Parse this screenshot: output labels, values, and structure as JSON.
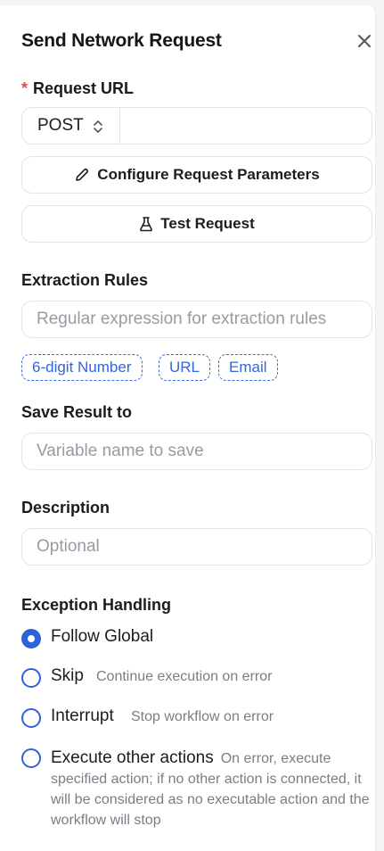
{
  "header": {
    "title": "Send Network Request"
  },
  "request_url": {
    "required_marker": "*",
    "label": "Request URL",
    "method": "POST",
    "value": ""
  },
  "buttons": {
    "configure": "Configure Request Parameters",
    "test": "Test Request"
  },
  "extraction": {
    "label": "Extraction Rules",
    "placeholder": "Regular expression for extraction rules",
    "tags": [
      "6-digit Number",
      "URL",
      "Email"
    ]
  },
  "save_result": {
    "label": "Save Result to",
    "placeholder": "Variable name to save"
  },
  "description": {
    "label": "Description",
    "placeholder": "Optional"
  },
  "exception": {
    "label": "Exception Handling",
    "selected": "follow_global",
    "options": [
      {
        "label": "Follow Global",
        "desc": ""
      },
      {
        "label": "Skip",
        "desc": "Continue execution on error"
      },
      {
        "label": "Interrupt",
        "desc": "Stop workflow on error"
      },
      {
        "label": "Execute other actions",
        "desc": "On error, execute specified action; if no other action is connected, it will be considered as no executable action and the workflow will stop"
      }
    ]
  },
  "colors": {
    "accent": "#2e62d9",
    "required": "#e5484d",
    "tag": "#3467d6"
  },
  "icons": {
    "close": "close-icon",
    "chevron": "chevron-up-down-icon",
    "pencil": "pencil-icon",
    "flask": "flask-icon"
  }
}
